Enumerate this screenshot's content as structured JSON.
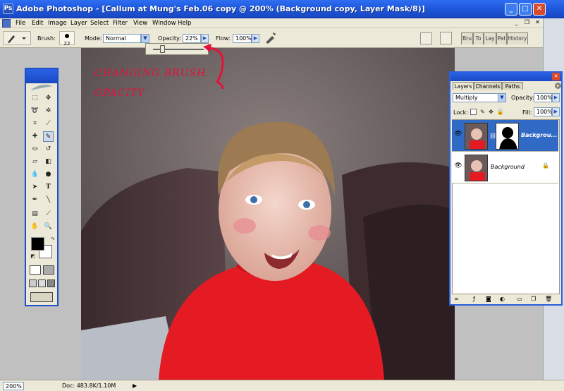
{
  "window": {
    "app_icon": "Ps",
    "title": "Adobe Photoshop - [Callum at Mung's Feb.06 copy @ 200% (Background copy, Layer Mask/8)]",
    "minimize": "_",
    "maximize": "□",
    "close": "✕"
  },
  "menu": {
    "items": [
      "File",
      "Edit",
      "Image",
      "Layer",
      "Select",
      "Filter",
      "View",
      "Window",
      "Help"
    ],
    "doc_minimize": "_",
    "doc_restore": "❐",
    "doc_close": "✕"
  },
  "options": {
    "brush_label": "Brush:",
    "brush_size": "22",
    "mode_label": "Mode:",
    "mode_value": "Normal",
    "opacity_label": "Opacity:",
    "opacity_value": "22%",
    "flow_label": "Flow:",
    "flow_value": "100%",
    "palette_tabs": [
      "Bru",
      "To",
      "Lay",
      "Pat",
      "History"
    ]
  },
  "annotation": {
    "line1": "CHANGING BRUSH",
    "line2": "OPACITY",
    "color": "#e4123a"
  },
  "layers_panel": {
    "tabs": [
      "Layers",
      "Channels",
      "Paths"
    ],
    "blend_mode": "Multiply",
    "opacity_label": "Opacity:",
    "opacity_value": "100%",
    "lock_label": "Lock:",
    "fill_label": "Fill:",
    "fill_value": "100%",
    "layers": [
      {
        "name": "Backgrou...",
        "selected": true
      },
      {
        "name": "Background",
        "selected": false
      }
    ],
    "close": "✕"
  },
  "status": {
    "zoom": "200%",
    "doc": "Doc: 483.8K/1.10M"
  },
  "colors": {
    "title_blue": "#1e55d8",
    "panel_bg": "#ece9d8",
    "selection": "#316ac5",
    "foreground": "#000000",
    "background": "#ffffff"
  }
}
